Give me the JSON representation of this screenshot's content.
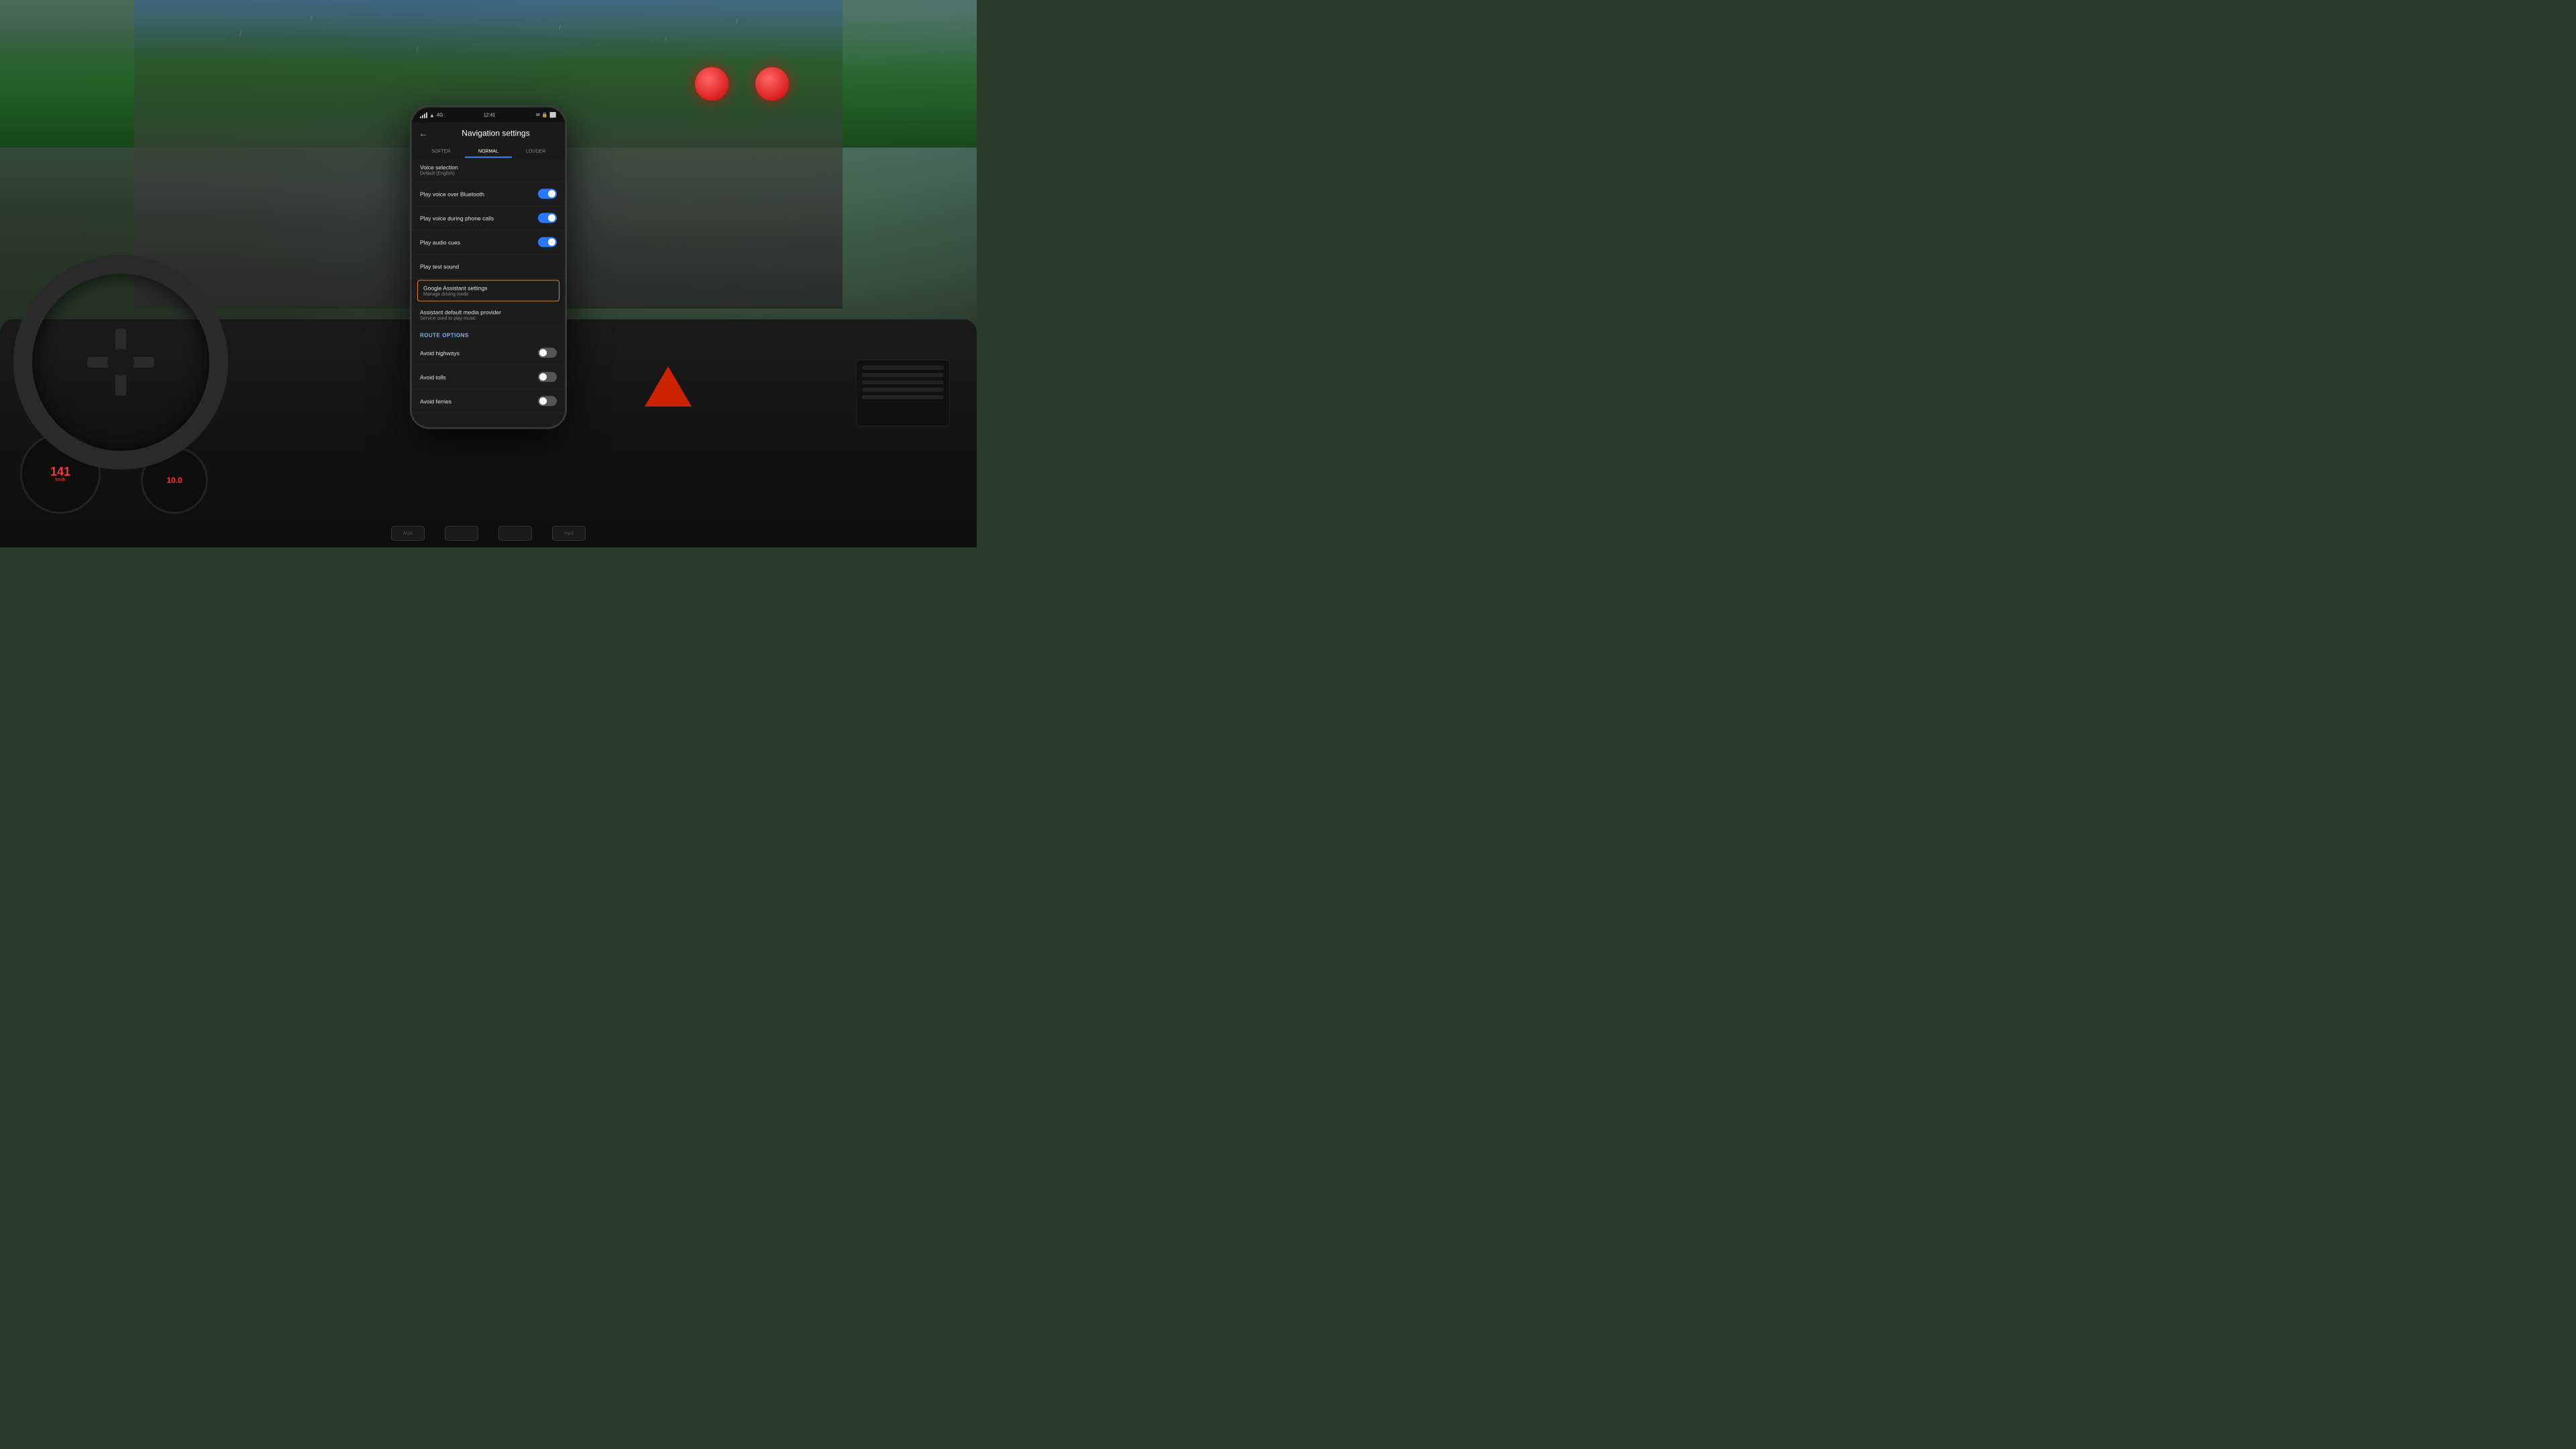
{
  "scene": {
    "background_description": "Car interior with rainy windshield, dashboard view"
  },
  "phone": {
    "status_bar": {
      "time": "12:41",
      "signal": "4G",
      "wifi": "wifi",
      "battery": "100"
    },
    "screen": {
      "title": "Navigation settings",
      "back_label": "←",
      "volume_tabs": [
        {
          "label": "SOFTER",
          "active": false
        },
        {
          "label": "NORMAL",
          "active": true
        },
        {
          "label": "LOUDER",
          "active": false
        }
      ],
      "settings": [
        {
          "id": "voice_selection",
          "label": "Voice selection",
          "sublabel": "Default (English)",
          "type": "nav",
          "toggle": null
        },
        {
          "id": "play_voice_bluetooth",
          "label": "Play voice over Bluetooth",
          "sublabel": null,
          "type": "toggle",
          "toggle_on": true
        },
        {
          "id": "play_voice_calls",
          "label": "Play voice during phone calls",
          "sublabel": null,
          "type": "toggle",
          "toggle_on": true
        },
        {
          "id": "play_audio_cues",
          "label": "Play audio cues",
          "sublabel": null,
          "type": "toggle",
          "toggle_on": true
        },
        {
          "id": "play_test_sound",
          "label": "Play test sound",
          "sublabel": null,
          "type": "button",
          "toggle": null
        },
        {
          "id": "google_assistant",
          "label": "Google Assistant settings",
          "sublabel": "Manage driving mode",
          "type": "highlighted_nav",
          "toggle": null
        },
        {
          "id": "assistant_media",
          "label": "Assistant default media provider",
          "sublabel": "Service used to play music",
          "type": "nav",
          "toggle": null
        }
      ],
      "route_options": {
        "section_title": "Route options",
        "items": [
          {
            "id": "avoid_highways",
            "label": "Avoid highways",
            "toggle_on": false
          },
          {
            "id": "avoid_tolls",
            "label": "Avoid tolls",
            "toggle_on": false
          },
          {
            "id": "avoid_ferries",
            "label": "Avoid ferries",
            "toggle_on": false
          }
        ]
      }
    }
  },
  "dashboard": {
    "speed": "141",
    "speed_unit": "km/h",
    "rpm": "10.0",
    "bottom_buttons": [
      {
        "label": "AUX"
      },
      {
        "label": ""
      },
      {
        "label": ""
      },
      {
        "label": "mp3"
      }
    ]
  }
}
